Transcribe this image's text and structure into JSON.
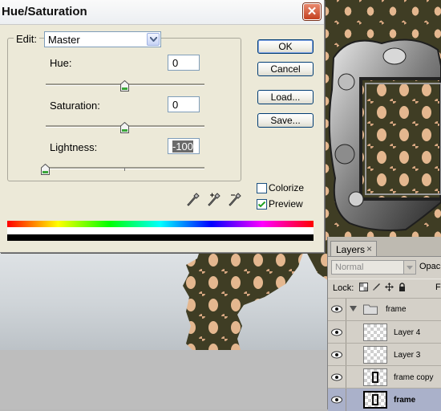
{
  "dialog": {
    "title": "Hue/Saturation",
    "close_symbol": "✕",
    "edit": {
      "label": "Edit:",
      "value": "Master"
    },
    "hue": {
      "label": "Hue:",
      "value": "0",
      "level": 0
    },
    "saturation": {
      "label": "Saturation:",
      "value": "0",
      "level": 0
    },
    "lightness": {
      "label": "Lightness:",
      "value": "-100",
      "level": -100
    },
    "buttons": {
      "ok": "OK",
      "cancel": "Cancel",
      "load": "Load...",
      "save": "Save..."
    },
    "colorize": {
      "label": "Colorize",
      "checked": false
    },
    "preview": {
      "label": "Preview",
      "checked": true
    },
    "eyedroppers": [
      "eyedropper-icon",
      "eyedropper-plus-icon",
      "eyedropper-minus-icon"
    ]
  },
  "layers_panel": {
    "tab_label": "Layers",
    "tab_close": "×",
    "blend_mode": "Normal",
    "opacity_label": "Opacit",
    "lock_label": "Lock:",
    "fill_label": "Fi",
    "layers": [
      {
        "name": "frame",
        "type": "group",
        "visible": true,
        "selected": false
      },
      {
        "name": "Layer 4",
        "type": "layer",
        "visible": true,
        "selected": false
      },
      {
        "name": "Layer 3",
        "type": "layer",
        "visible": true,
        "selected": false
      },
      {
        "name": "frame copy",
        "type": "layer",
        "visible": true,
        "selected": false
      },
      {
        "name": "frame",
        "type": "layer",
        "visible": true,
        "selected": true
      }
    ]
  },
  "colors": {
    "dialog_bg": "#ece9d8",
    "close_button": "#c4401f",
    "damask_dark": "#3f3d24",
    "damask_light": "#e4b78f",
    "selected_layer": "#aab1ca"
  }
}
